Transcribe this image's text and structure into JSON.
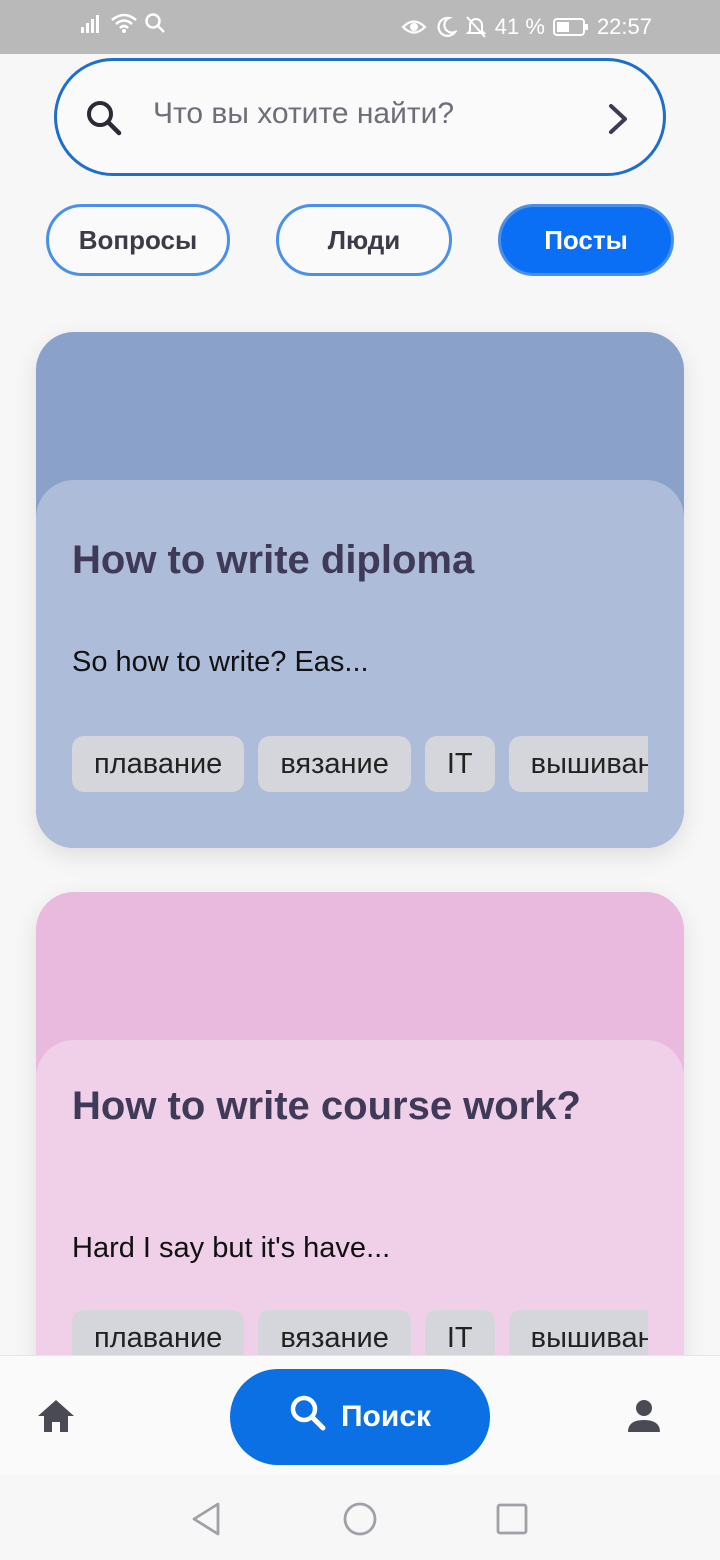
{
  "status_bar": {
    "battery_percent": "41 %",
    "time": "22:57",
    "icons": [
      "signal-icon",
      "wifi-icon",
      "search-status-icon",
      "eye-icon",
      "moon-icon",
      "bell-off-icon",
      "battery-icon"
    ]
  },
  "search": {
    "placeholder": "Что вы хотите найти?",
    "icon": "search-icon",
    "go_icon": "chevron-right-icon"
  },
  "filters": [
    {
      "label": "Вопросы",
      "active": false
    },
    {
      "label": "Люди",
      "active": false
    },
    {
      "label": "Посты",
      "active": true
    }
  ],
  "posts": [
    {
      "title": "How to write diploma",
      "excerpt": "So how to write? Eas...",
      "tags": [
        "плавание",
        "вязание",
        "IT",
        "вышивание"
      ]
    },
    {
      "title": "How to write course work?",
      "excerpt": "Hard I say but it's have...",
      "tags": [
        "плавание",
        "вязание",
        "IT",
        "вышивание"
      ]
    }
  ],
  "bottom_nav": {
    "search_label": "Поиск",
    "items": [
      "home-icon",
      "search-icon",
      "profile-icon"
    ]
  },
  "colors": {
    "primary": "#0a6ff4",
    "card1_outer": "#8aa2c9",
    "card1_inner": "#adbcd9",
    "card2_outer": "#eab9de",
    "card2_inner": "#f0cfe8",
    "title_text": "#3f3a58"
  }
}
